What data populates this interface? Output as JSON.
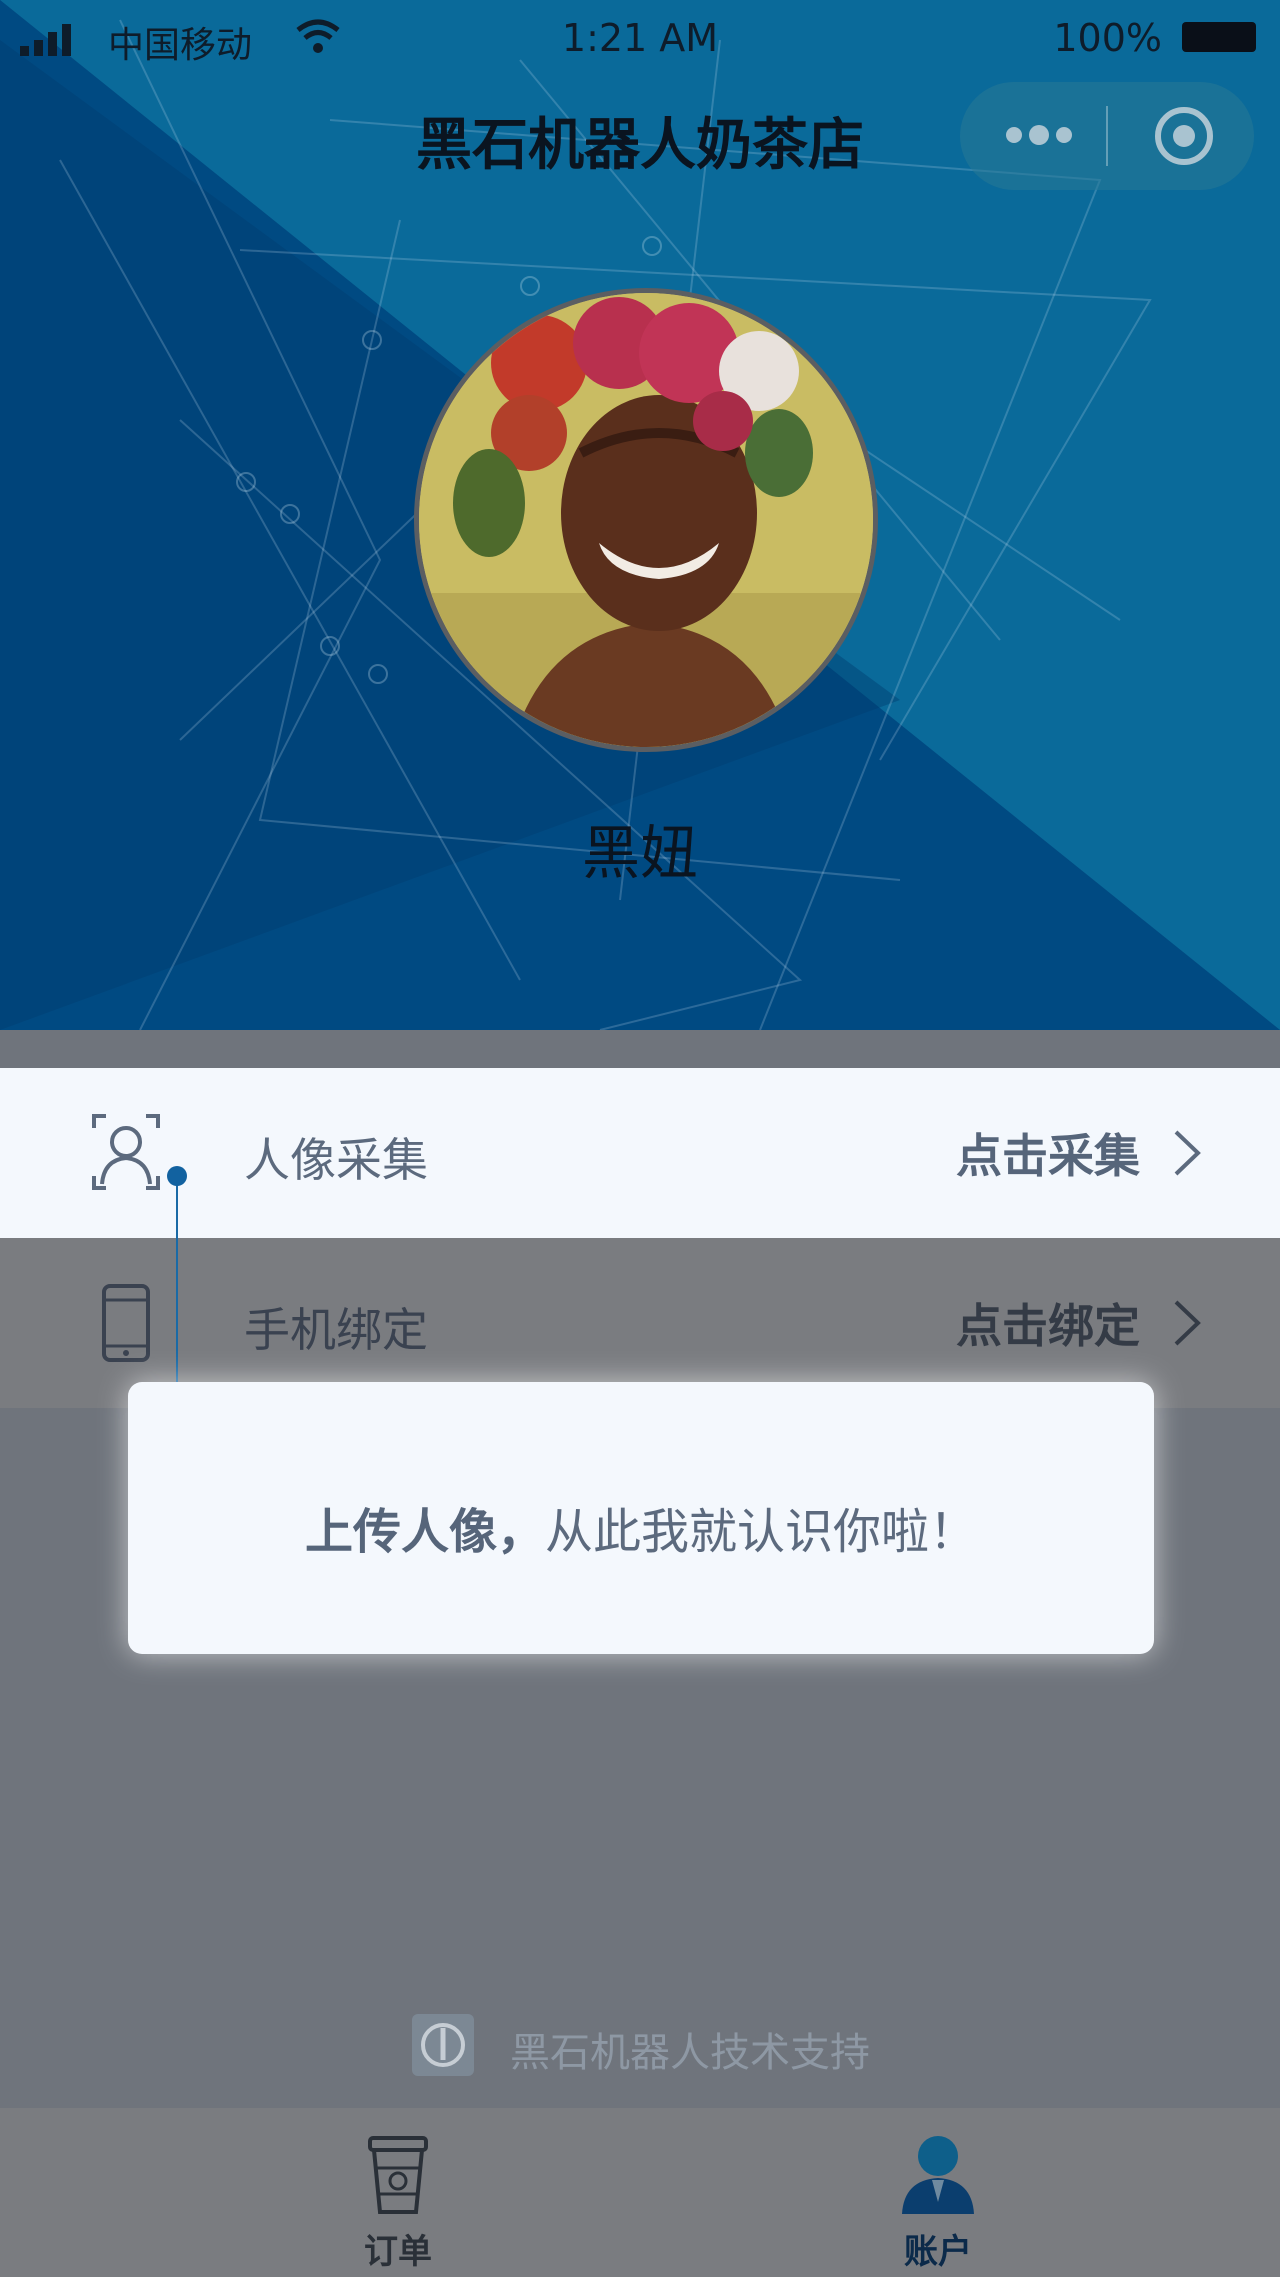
{
  "statusbar": {
    "carrier": "中国移动",
    "time": "1:21 AM",
    "battery": "100%"
  },
  "header": {
    "title": "黑石机器人奶茶店",
    "username": "黑妞"
  },
  "menu": [
    {
      "label": "人像采集",
      "action": "点击采集",
      "icon": "face-scan-icon"
    },
    {
      "label": "手机绑定",
      "action": "点击绑定",
      "icon": "phone-icon"
    }
  ],
  "tooltip": {
    "bold": "上传人像，",
    "rest": "从此我就认识你啦！"
  },
  "footer": {
    "support": "黑石机器人技术支持"
  },
  "tabbar": [
    {
      "label": "订单",
      "icon": "cup-icon"
    },
    {
      "label": "账户",
      "icon": "user-icon"
    }
  ],
  "colors": {
    "header_dark": "#003e72",
    "header_light": "#0a6a9a",
    "accent": "#1262a0",
    "overlay": "#6f747c"
  }
}
